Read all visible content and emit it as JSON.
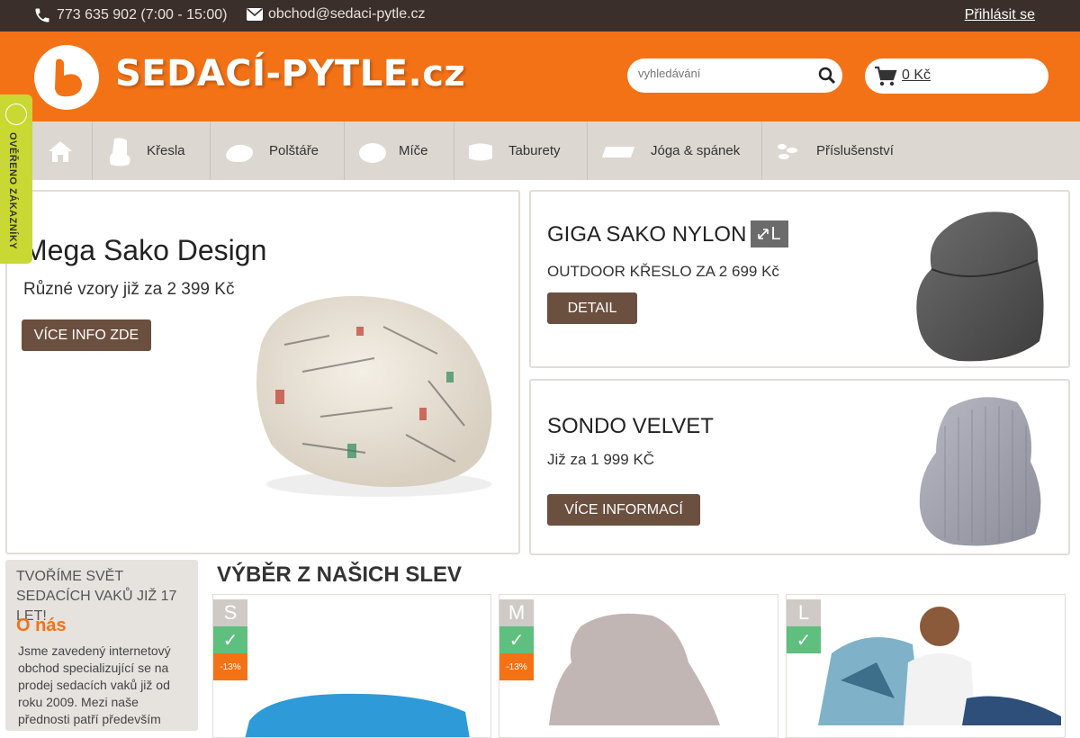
{
  "topbar": {
    "phone": "773 635 902 (7:00 - 15:00)",
    "email": "obchod@sedaci-pytle.cz",
    "login": "Přihlásit se"
  },
  "header": {
    "logo": "SEDACÍ-PYTLE.cz",
    "search_placeholder": "vyhledávání",
    "cart": "0 Kč"
  },
  "nav": {
    "items": [
      {
        "label": "Křesla",
        "icon": "armchair-icon"
      },
      {
        "label": "Polštáře",
        "icon": "pillow-icon"
      },
      {
        "label": "Míče",
        "icon": "ball-icon"
      },
      {
        "label": "Taburety",
        "icon": "pouf-icon"
      },
      {
        "label": "Jóga & spánek",
        "icon": "mat-icon"
      },
      {
        "label": "Příslušenství",
        "icon": "accessories-icon"
      }
    ]
  },
  "verified_badge": "OVĚŘENO ZÁKAZNÍKY",
  "promos": {
    "main": {
      "title": "Mega Sako Design",
      "subtitle": "Různé vzory již za 2 399 Kč",
      "button": "VÍCE INFO ZDE"
    },
    "giga": {
      "title": "GIGA SAKO NYLON",
      "size": "L",
      "subtitle": "OUTDOOR KŘESLO ZA 2 699 Kč",
      "button": "DETAIL"
    },
    "sondo": {
      "title": "SONDO VELVET",
      "subtitle": "Již za 1 999 KČ",
      "button": "VÍCE INFORMACÍ"
    }
  },
  "about": {
    "heading": "TVOŘÍME SVĚT SEDACÍCH VAKŮ JIŽ 17 LET!",
    "title": "O nás",
    "text": "Jsme zavedený internetový obchod specializující se na prodej sedacích vaků již od roku 2009. Mezi naše přednosti patří především"
  },
  "discounts": {
    "title": "VÝBĚR Z NAŠICH SLEV",
    "cards": [
      {
        "size": "S",
        "check": "✓",
        "discount": "-13%"
      },
      {
        "size": "M",
        "check": "✓",
        "discount": "-13%"
      },
      {
        "size": "L",
        "check": "✓",
        "discount": ""
      }
    ]
  },
  "colors": {
    "orange": "#f47216",
    "brown": "#6b4f3f",
    "topbar": "#3a2f2a",
    "nav": "#dcd7d1",
    "green": "#5ebf7e",
    "badge": "#c9d833"
  }
}
